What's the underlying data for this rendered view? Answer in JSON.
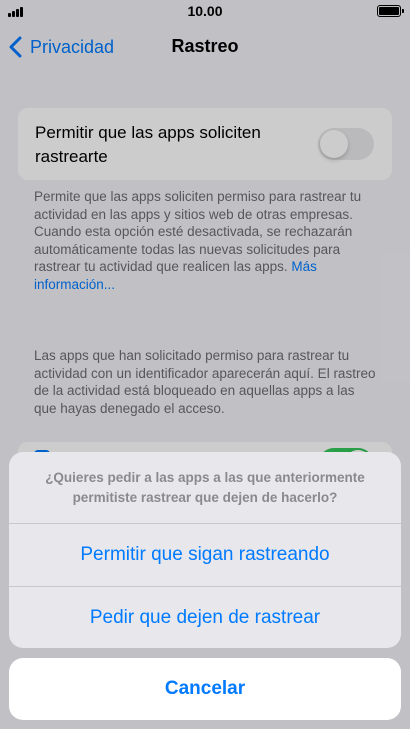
{
  "status_bar": {
    "time": "10.00"
  },
  "nav": {
    "back_label": "Privacidad",
    "title": "Rastreo"
  },
  "tracking_setting": {
    "label": "Permitir que las apps soliciten rastrearte",
    "enabled": false
  },
  "footnote_1": {
    "text": "Permite que las apps soliciten permiso para rastrear tu actividad en las apps y sitios web de otras empresas. Cuando esta opción esté desactivada, se rechazarán automáticamente todas las nuevas solicitudes para rastrear tu actividad que realicen las apps.",
    "link": "Más información..."
  },
  "footnote_2": {
    "text": "Las apps que han solicitado permiso para rastrear tu actividad con un identificador aparecerán aquí. El rastreo de la actividad está bloqueado en aquellas apps a las que hayas denegado el acceso."
  },
  "action_sheet": {
    "message": "¿Quieres pedir a las apps a las que anteriormente permitiste rastrear que dejen de hacerlo?",
    "actions": [
      {
        "label": "Permitir que sigan rastreando"
      },
      {
        "label": "Pedir que dejen de rastrear"
      }
    ],
    "cancel_label": "Cancelar"
  },
  "colors": {
    "accent": "#007aff",
    "toggle_on": "#34c759",
    "background": "#f2f2f7"
  }
}
